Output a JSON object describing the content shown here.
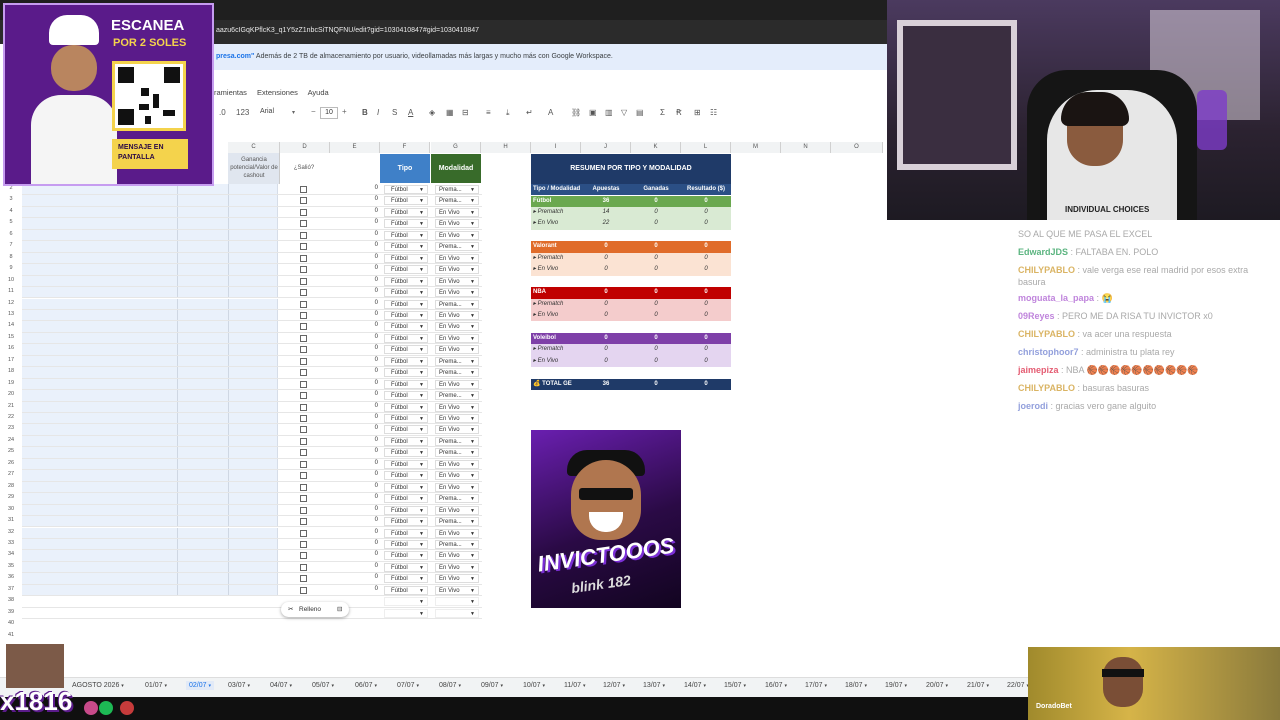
{
  "browser": {
    "url": "aazu6cIGqKPflcK3_q1Y5zZ1nbcSiTNQFNU/edit?gid=1030410847#gid=1030410847"
  },
  "promo_banner": {
    "brand": "presa.com\"",
    "text": "Además de 2 TB de almacenamiento por usuario, videollamadas más largas y mucho más con Google Workspace."
  },
  "menu": [
    "ramientas",
    "Extensiones",
    "Ayuda"
  ],
  "toolbar": {
    "number_format": "123",
    "font": "Arial",
    "font_size": "10"
  },
  "columns": [
    "C",
    "D",
    "E",
    "F",
    "G",
    "H",
    "I",
    "J",
    "K",
    "L",
    "M",
    "N",
    "O"
  ],
  "sheet_headers": {
    "ganancia": "Ganancia potencial/Valor de cashout",
    "salio": "¿Salió?",
    "tipo": "Tipo",
    "modalidad": "Modalidad"
  },
  "rows": [
    {
      "num": "2",
      "mod": "Prema..."
    },
    {
      "num": "3",
      "mod": "Prema..."
    },
    {
      "num": "4",
      "mod": "En Vivo"
    },
    {
      "num": "5",
      "mod": "En Vivo"
    },
    {
      "num": "6",
      "mod": "En Vivo"
    },
    {
      "num": "7",
      "mod": "Prema..."
    },
    {
      "num": "8",
      "mod": "En Vivo"
    },
    {
      "num": "9",
      "mod": "En Vivo"
    },
    {
      "num": "10",
      "mod": "En Vivo"
    },
    {
      "num": "11",
      "mod": "En Vivo"
    },
    {
      "num": "12",
      "mod": "Prema..."
    },
    {
      "num": "13",
      "mod": "En Vivo"
    },
    {
      "num": "14",
      "mod": "En Vivo"
    },
    {
      "num": "15",
      "mod": "En Vivo"
    },
    {
      "num": "16",
      "mod": "En Vivo"
    },
    {
      "num": "17",
      "mod": "Prema..."
    },
    {
      "num": "18",
      "mod": "Prema..."
    },
    {
      "num": "19",
      "mod": "En Vivo"
    },
    {
      "num": "20",
      "mod": "Preme..."
    },
    {
      "num": "21",
      "mod": "En Vivo"
    },
    {
      "num": "22",
      "mod": "En Vivo"
    },
    {
      "num": "23",
      "mod": "En Vivo"
    },
    {
      "num": "24",
      "mod": "Prema..."
    },
    {
      "num": "25",
      "mod": "Prema..."
    },
    {
      "num": "26",
      "mod": "En Vivo"
    },
    {
      "num": "27",
      "mod": "En Vivo"
    },
    {
      "num": "28",
      "mod": "En Vivo"
    },
    {
      "num": "29",
      "mod": "Prema..."
    },
    {
      "num": "30",
      "mod": "En Vivo"
    },
    {
      "num": "31",
      "mod": "Prema..."
    },
    {
      "num": "32",
      "mod": "En Vivo"
    },
    {
      "num": "33",
      "mod": "Prema..."
    },
    {
      "num": "34",
      "mod": "En Vivo"
    },
    {
      "num": "35",
      "mod": "En Vivo"
    },
    {
      "num": "36",
      "mod": "En Vivo"
    },
    {
      "num": "37",
      "mod": "En Vivo"
    }
  ],
  "row_defaults": {
    "zero": "0",
    "tipo": "Fútbol"
  },
  "trailing_rows": [
    "38",
    "39",
    "40",
    "41"
  ],
  "summary": {
    "title": "RESUMEN POR TIPO Y MODALIDAD",
    "headers": [
      "Tipo / Modalidad",
      "Apuestas",
      "Ganadas",
      "Resultado ($)"
    ],
    "rows": [
      {
        "label": "Fútbol",
        "vals": [
          "36",
          "0",
          "0"
        ],
        "kind": "main",
        "color": "#6aa84f",
        "text": "#ffffff"
      },
      {
        "label": "▸ Prematch",
        "vals": [
          "14",
          "0",
          "0"
        ],
        "kind": "sub",
        "color": "#d9ead3",
        "text": "#333333"
      },
      {
        "label": "▸ En Vivo",
        "vals": [
          "22",
          "0",
          "0"
        ],
        "kind": "sub",
        "color": "#d9ead3",
        "text": "#333333"
      },
      {
        "label": "",
        "vals": [
          "",
          "",
          ""
        ],
        "kind": "blank",
        "color": "#ffffff",
        "text": "#333333"
      },
      {
        "label": "Valorant",
        "vals": [
          "0",
          "0",
          "0"
        ],
        "kind": "main",
        "color": "#e06c2a",
        "text": "#ffffff"
      },
      {
        "label": "▸ Prematch",
        "vals": [
          "0",
          "0",
          "0"
        ],
        "kind": "sub",
        "color": "#fbe3d3",
        "text": "#333333"
      },
      {
        "label": "▸ En Vivo",
        "vals": [
          "0",
          "0",
          "0"
        ],
        "kind": "sub",
        "color": "#fbe3d3",
        "text": "#333333"
      },
      {
        "label": "",
        "vals": [
          "",
          "",
          ""
        ],
        "kind": "blank",
        "color": "#ffffff",
        "text": "#333333"
      },
      {
        "label": "NBA",
        "vals": [
          "0",
          "0",
          "0"
        ],
        "kind": "main",
        "color": "#c00000",
        "text": "#ffffff"
      },
      {
        "label": "▸ Prematch",
        "vals": [
          "0",
          "0",
          "0"
        ],
        "kind": "sub",
        "color": "#f4cccc",
        "text": "#333333"
      },
      {
        "label": "▸ En Vivo",
        "vals": [
          "0",
          "0",
          "0"
        ],
        "kind": "sub",
        "color": "#f4cccc",
        "text": "#333333"
      },
      {
        "label": "",
        "vals": [
          "",
          "",
          ""
        ],
        "kind": "blank",
        "color": "#ffffff",
        "text": "#333333"
      },
      {
        "label": "Voleibol",
        "vals": [
          "0",
          "0",
          "0"
        ],
        "kind": "main",
        "color": "#7e3fa8",
        "text": "#ffffff"
      },
      {
        "label": "▸ Prematch",
        "vals": [
          "0",
          "0",
          "0"
        ],
        "kind": "sub",
        "color": "#e4d5f0",
        "text": "#333333"
      },
      {
        "label": "▸ En Vivo",
        "vals": [
          "0",
          "0",
          "0"
        ],
        "kind": "sub",
        "color": "#e4d5f0",
        "text": "#333333"
      },
      {
        "label": "",
        "vals": [
          "",
          "",
          ""
        ],
        "kind": "blank",
        "color": "#ffffff",
        "text": "#333333"
      },
      {
        "label": "💰 TOTAL GE",
        "vals": [
          "36",
          "0",
          "0"
        ],
        "kind": "total",
        "color": "#1f3a68",
        "text": "#ffffff"
      }
    ]
  },
  "promo_image": {
    "word": "INVICTOOOS",
    "sub": "blink 182"
  },
  "relleno": "Relleno",
  "tabs": [
    "AGOSTO 2026",
    "01/07",
    "02/07",
    "03/07",
    "04/07",
    "05/07",
    "06/07",
    "07/07",
    "08/07",
    "09/07",
    "10/07",
    "11/07",
    "12/07",
    "13/07",
    "14/07",
    "15/07",
    "16/07",
    "17/07",
    "18/07",
    "19/07",
    "20/07",
    "21/07",
    "22/07"
  ],
  "active_tab": "02/07",
  "qr_overlay": {
    "title": "ESCANEA",
    "subtitle": "POR 2 SOLES",
    "button": "MENSAJE EN PANTALLA"
  },
  "cam_shirt": "INDIVIDUAL CHOICES",
  "chat": [
    {
      "user": "",
      "msg": "SO AL QUE ME PASA EL EXCEL",
      "color": "#9a9a9a"
    },
    {
      "user": "EdwardJDS",
      "msg": " : FALTABA EN. POLO",
      "color": "#3fa86a"
    },
    {
      "user": "CHILYPABLO",
      "msg": " : vale verga ese real madrid por esos extra basura",
      "color": "#d4a84a"
    },
    {
      "user": "moguata_la_papa",
      "msg": " : 😭",
      "color": "#b56fd6"
    },
    {
      "user": "09Reyes",
      "msg": " : PERO ME DA RISA TU INVICTOR x0",
      "color": "#b56fd6"
    },
    {
      "user": "CHILYPABLO",
      "msg": " : va acer una respuesta",
      "color": "#d4a84a"
    },
    {
      "user": "christophoor7",
      "msg": " : administra tu plata rey",
      "color": "#7f8fd6"
    },
    {
      "user": "jaimepiza",
      "msg": " : NBA 🏀🏀🏀🏀🏀🏀🏀🏀🏀🏀",
      "color": "#e0405a"
    },
    {
      "user": "CHILYPABLO",
      "msg": " : basuras basuras",
      "color": "#d4a84a"
    },
    {
      "user": "joerodi",
      "msg": " : gracias vero gane alguito",
      "color": "#7f8fd6"
    }
  ],
  "sponsor": "DoradoBet",
  "sub_counter": "x1816"
}
